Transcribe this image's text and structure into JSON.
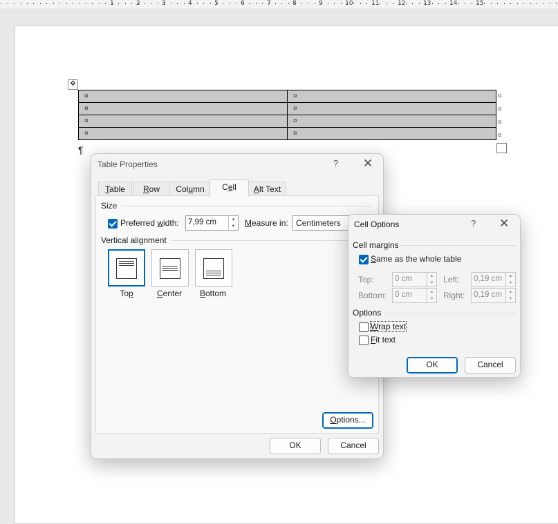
{
  "ruler": {
    "numbers": [
      "1",
      "2",
      "3",
      "4",
      "5",
      "6",
      "7",
      "8",
      "9",
      "10",
      "11",
      "12",
      "13",
      "14",
      "15"
    ]
  },
  "document": {
    "table": {
      "rows": [
        [
          "¤",
          "¤"
        ],
        [
          "¤",
          "¤"
        ],
        [
          "¤",
          "¤"
        ],
        [
          "¤",
          "¤"
        ]
      ],
      "row_end_mark": "¤"
    },
    "paragraph_mark": "¶",
    "move_handle_icon": "move-arrows-icon"
  },
  "table_properties": {
    "title": "Table Properties",
    "help": "?",
    "close": "✕",
    "tabs": [
      {
        "label": "Table",
        "key": "T",
        "rest": "able",
        "pre": ""
      },
      {
        "label": "Row",
        "key": "R",
        "rest": "ow",
        "pre": ""
      },
      {
        "label": "Column",
        "key": "U",
        "rest": "mn",
        "pre": "Col"
      },
      {
        "label": "Cell",
        "key": "E",
        "rest": "ll",
        "pre": "C"
      },
      {
        "label": "Alt Text",
        "key": "A",
        "rest": "lt Text",
        "pre": ""
      }
    ],
    "active_tab": "Cell",
    "size_group": "Size",
    "preferred_width_label_pre": "Preferred ",
    "preferred_width_label_key": "w",
    "preferred_width_label_post": "idth:",
    "preferred_width_checked": true,
    "preferred_width_value": "7,99 cm",
    "measure_in_label_key": "M",
    "measure_in_label_post": "easure in:",
    "measure_in_value": "Centimeters",
    "vertical_alignment_group": "Vertical alignment",
    "alignments": [
      {
        "label_key": "p",
        "label_pre": "To",
        "label_post": "",
        "selected": true
      },
      {
        "label_key": "C",
        "label_pre": "",
        "label_post": "enter",
        "selected": false
      },
      {
        "label_key": "B",
        "label_pre": "",
        "label_post": "ottom",
        "selected": false
      }
    ],
    "options_button": {
      "key": "O",
      "rest": "ptions..."
    },
    "ok": "OK",
    "cancel": "Cancel"
  },
  "cell_options": {
    "title": "Cell Options",
    "help": "?",
    "close": "✕",
    "cell_margins_group": "Cell margins",
    "same_as_table_key": "S",
    "same_as_table_rest": "ame as the whole table",
    "same_as_table_checked": true,
    "top_label": "Top:",
    "top_value": "0 cm",
    "left_label": "Left:",
    "left_value": "0,19 cm",
    "bottom_label": "Bottom:",
    "bottom_value": "0 cm",
    "right_label": "Right:",
    "right_value": "0,19 cm",
    "options_group": "Options",
    "wrap_text_key": "W",
    "wrap_text_rest": "rap text",
    "wrap_text_checked": false,
    "fit_text_key": "F",
    "fit_text_rest": "it text",
    "fit_text_checked": false,
    "ok": "OK",
    "cancel": "Cancel"
  }
}
